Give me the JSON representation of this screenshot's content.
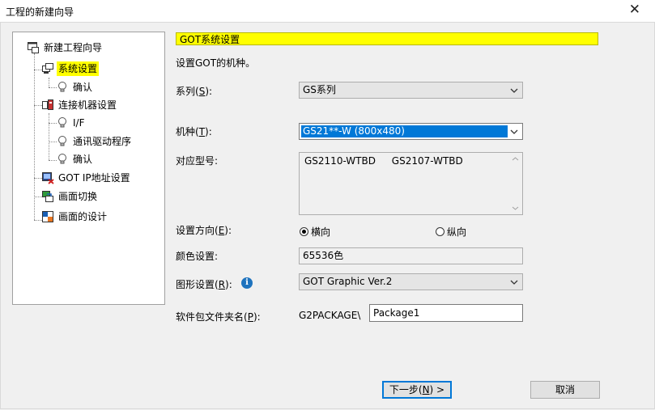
{
  "window": {
    "title": "工程的新建向导"
  },
  "tree": {
    "root": "新建工程向导",
    "items": [
      {
        "label": "系统设置",
        "selected": true
      },
      {
        "label": "确认"
      },
      {
        "label": "连接机器设置"
      },
      {
        "label": "I/F"
      },
      {
        "label": "通讯驱动程序"
      },
      {
        "label": "确认"
      },
      {
        "label": "GOT IP地址设置"
      },
      {
        "label": "画面切换"
      },
      {
        "label": "画面的设计"
      }
    ]
  },
  "section": {
    "header": "GOT系统设置",
    "description": "设置GOT的机种。"
  },
  "form": {
    "series_label_pre": "系列(",
    "series_key": "S",
    "series_label_post": "):",
    "series_value": "GS系列",
    "model_label_pre": "机种(",
    "model_key": "T",
    "model_label_post": "):",
    "model_value": "GS21**-W (800x480)",
    "compatible_label": "对应型号:",
    "compatible_items": [
      "GS2110-WTBD",
      "GS2107-WTBD"
    ],
    "orientation_label_pre": "设置方向(",
    "orientation_key": "E",
    "orientation_label_post": "):",
    "orientation_horizontal": "横向",
    "orientation_vertical": "纵向",
    "color_label": "颜色设置:",
    "color_value": "65536色",
    "graphic_label_pre": "图形设置(",
    "graphic_key": "R",
    "graphic_label_post": "):",
    "graphic_value": "GOT Graphic Ver.2",
    "package_label_pre": "软件包文件夹名(",
    "package_key": "P",
    "package_label_post": "):",
    "package_prefix": "G2PACKAGE\\",
    "package_value": "Package1"
  },
  "buttons": {
    "next_pre": "下一步(",
    "next_key": "N",
    "next_post": ") >",
    "cancel": "取消"
  },
  "icons": {
    "close": "close-icon",
    "project": "project-wizard-icon",
    "system": "system-settings-icon",
    "bulb": "lightbulb-icon",
    "connection": "connection-device-icon",
    "ip": "ip-address-icon",
    "screen_switch": "screen-switch-icon",
    "screen_design": "screen-design-icon",
    "info": "info-icon"
  }
}
